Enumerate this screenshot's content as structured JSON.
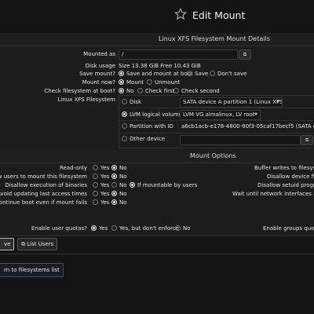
{
  "page": {
    "title": "Edit Mount"
  },
  "details": {
    "header": "Linux XFS Filesystem Mount Details",
    "mounted_as": {
      "label": "Mounted as",
      "value": "/"
    },
    "disk_usage": {
      "label": "Disk usage",
      "value": "Size 13.38 GiB Free 10.43 GiB"
    },
    "save_mount": {
      "label": "Save mount?",
      "options": [
        "Save and mount at boot",
        "Save",
        "Don't save"
      ],
      "selected": 0
    },
    "mount_now": {
      "label": "Mount now?",
      "options": [
        "Mount",
        "Unmount"
      ],
      "selected": 0
    },
    "check_fs": {
      "label": "Check filesystem at boot?",
      "options": [
        "No",
        "Check first",
        "Check second"
      ],
      "selected": 0
    },
    "fs_source": {
      "label": "Linux XFS Filesystem",
      "options": [
        "Disk",
        "LVM logical volume",
        "Partition with ID",
        "Other device"
      ],
      "selected": 1,
      "disk_select": "SATA device A partition 1 (Linux XFS)",
      "lvm_select": "LVM VG almalinux, LV root",
      "partition_id": "a6cb1acb-e178-4800-90f3-05caf17becf5 (SATA device"
    }
  },
  "options": {
    "header": "Mount Options",
    "rows": [
      {
        "label": "Read-only",
        "options": [
          "Yes",
          "No"
        ],
        "selected": 1
      },
      {
        "label": "Allow users to mount this filesystem",
        "options": [
          "Yes",
          "No"
        ],
        "selected": 1
      },
      {
        "label": "Disallow execution of binaries",
        "options": [
          "Yes",
          "No",
          "If mountable by users"
        ],
        "selected": 2
      },
      {
        "label": "Avoid updating last access times",
        "options": [
          "Yes",
          "No"
        ],
        "selected": 1
      },
      {
        "label": "Continue boot even if mount fails",
        "options": [
          "Yes",
          "No"
        ],
        "selected": 1
      }
    ],
    "right_labels": [
      "Buffer writes to filesyste",
      "Disallow device fil",
      "Disallow setuid program",
      "Wait until network interfaces are u"
    ],
    "quotas": {
      "label": "Enable user quotas?",
      "options": [
        "Yes",
        "Yes, but don't enforce",
        "No"
      ],
      "selected": 0
    },
    "group_quotas_label": "Enable groups quota"
  },
  "buttons": {
    "save": "ve",
    "list_users": "List Users",
    "return": "rn to filesystems list"
  },
  "icons": {
    "star": "star-outline-icon",
    "picker": "file-picker-icon",
    "users": "users-icon"
  }
}
